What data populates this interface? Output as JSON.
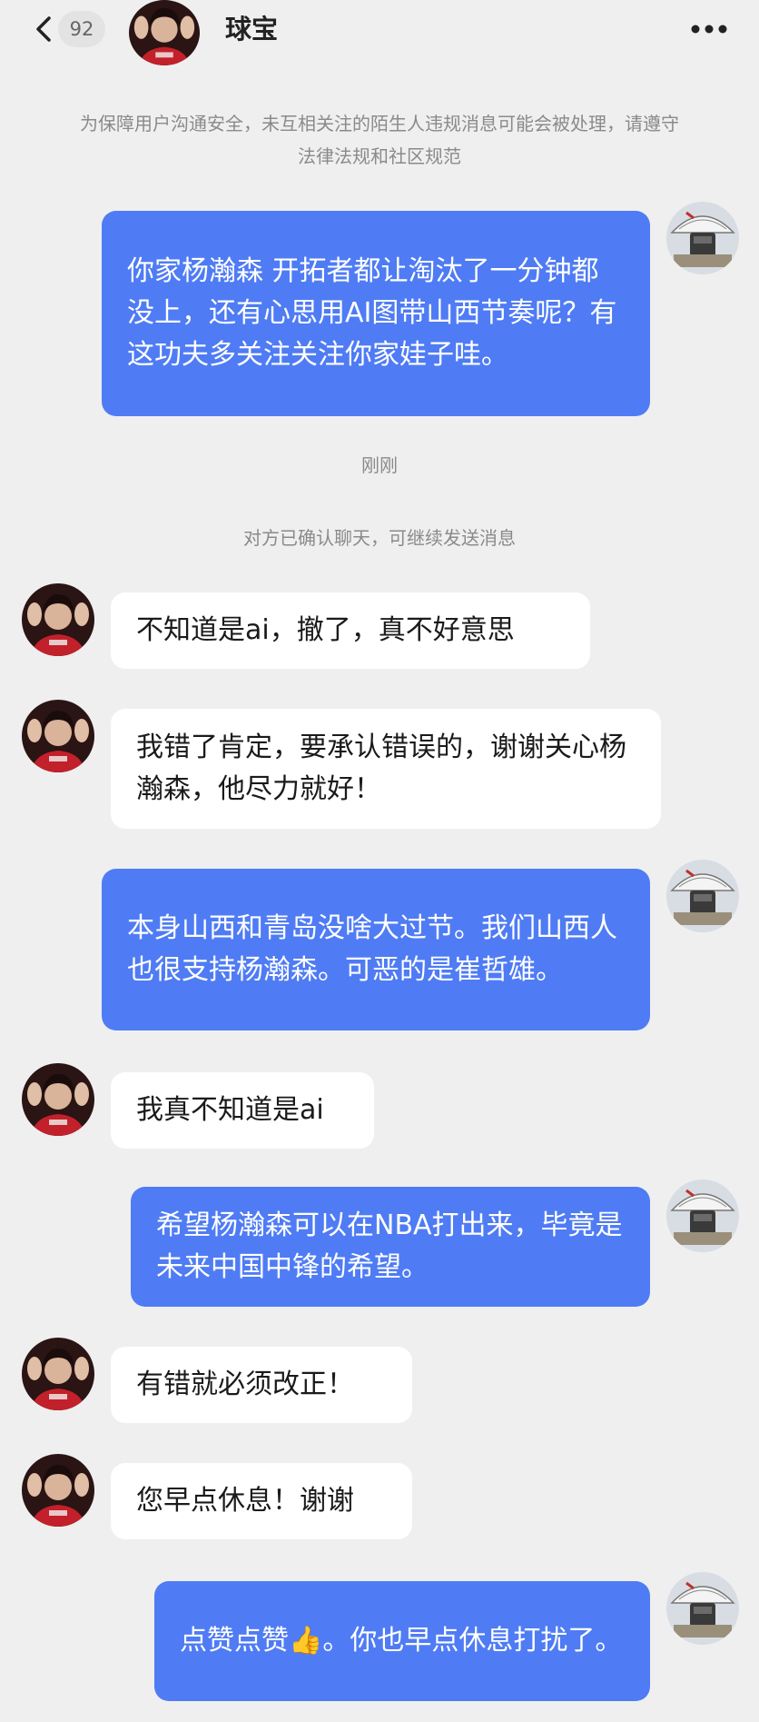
{
  "header": {
    "back_icon": "chevron-left-icon",
    "unread_count": "92",
    "contact_name": "球宝",
    "more_icon": "more-horizontal-icon"
  },
  "notice": "为保障用户沟通安全，未互相关注的陌生人违规消息可能会被处理，请遵守法律法规和社区规范",
  "time_label": "刚刚",
  "status_label": "对方已确认聊天，可继续发送消息",
  "messages": [
    {
      "side": "out",
      "text": "你家杨瀚森 开拓者都让淘汰了一分钟都没上，还有心思用AI图带山西节奏呢？有这功夫多关注关注你家娃子哇。"
    },
    {
      "side": "in",
      "text": "不知道是ai，撤了，真不好意思"
    },
    {
      "side": "in",
      "text": "我错了肯定，要承认错误的，谢谢关心杨瀚森，他尽力就好！"
    },
    {
      "side": "out",
      "text": "本身山西和青岛没啥大过节。我们山西人也很支持杨瀚森。可恶的是崔哲雄。"
    },
    {
      "side": "in",
      "text": "我真不知道是ai"
    },
    {
      "side": "out",
      "text": "希望杨瀚森可以在NBA打出来，毕竟是未来中国中锋的希望。"
    },
    {
      "side": "in",
      "text": "有错就必须改正！"
    },
    {
      "side": "in",
      "text": "您早点休息！谢谢"
    },
    {
      "side": "out",
      "text": "点赞点赞👍。你也早点休息打扰了。"
    }
  ],
  "colors": {
    "background": "#efefef",
    "outgoing_bubble": "#4f7cf4",
    "incoming_bubble": "#ffffff"
  }
}
